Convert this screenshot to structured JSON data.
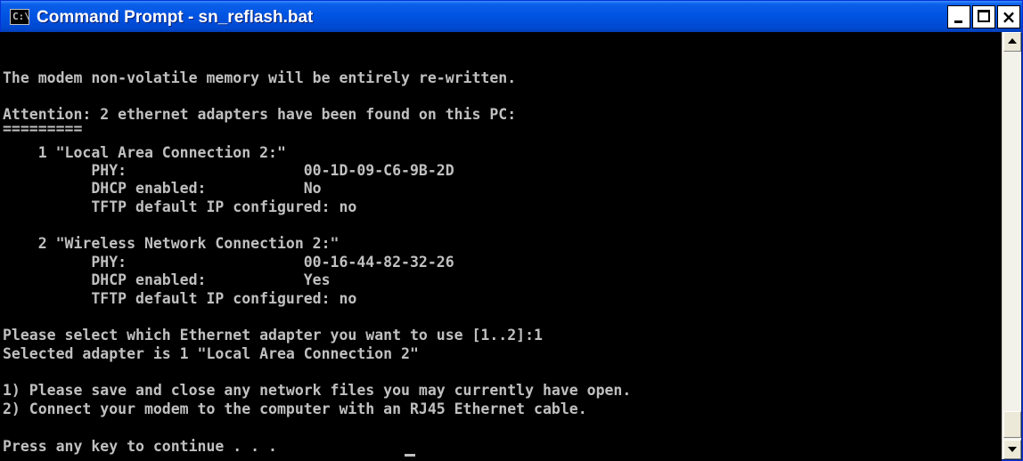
{
  "window": {
    "title": "Command Prompt - sn_reflash.bat",
    "icon_label": "C:\\",
    "icon": "console-app-icon",
    "controls": {
      "minimize": "minimize-icon",
      "maximize": "maximize-icon",
      "close_glyph": "×"
    }
  },
  "console": {
    "lines": [
      "",
      "The modem non-volatile memory will be entirely re-written.",
      "",
      "Attention: 2 ethernet adapters have been found on this PC:",
      "=========",
      "    1 \"Local Area Connection 2:\"",
      "          PHY:                    00-1D-09-C6-9B-2D",
      "          DHCP enabled:           No",
      "          TFTP default IP configured: no",
      "",
      "    2 \"Wireless Network Connection 2:\"",
      "          PHY:                    00-16-44-82-32-26",
      "          DHCP enabled:           Yes",
      "          TFTP default IP configured: no",
      "",
      "Please select which Ethernet adapter you want to use [1..2]:1",
      "Selected adapter is 1 \"Local Area Connection 2\"",
      "",
      "1) Please save and close any network files you may currently have open.",
      "2) Connect your modem to the computer with an RJ45 Ethernet cable.",
      "",
      "Press any key to continue . . ."
    ]
  },
  "colors": {
    "console_bg": "#000000",
    "console_text": "#c0c0c0",
    "titlebar": "#0054e3"
  }
}
